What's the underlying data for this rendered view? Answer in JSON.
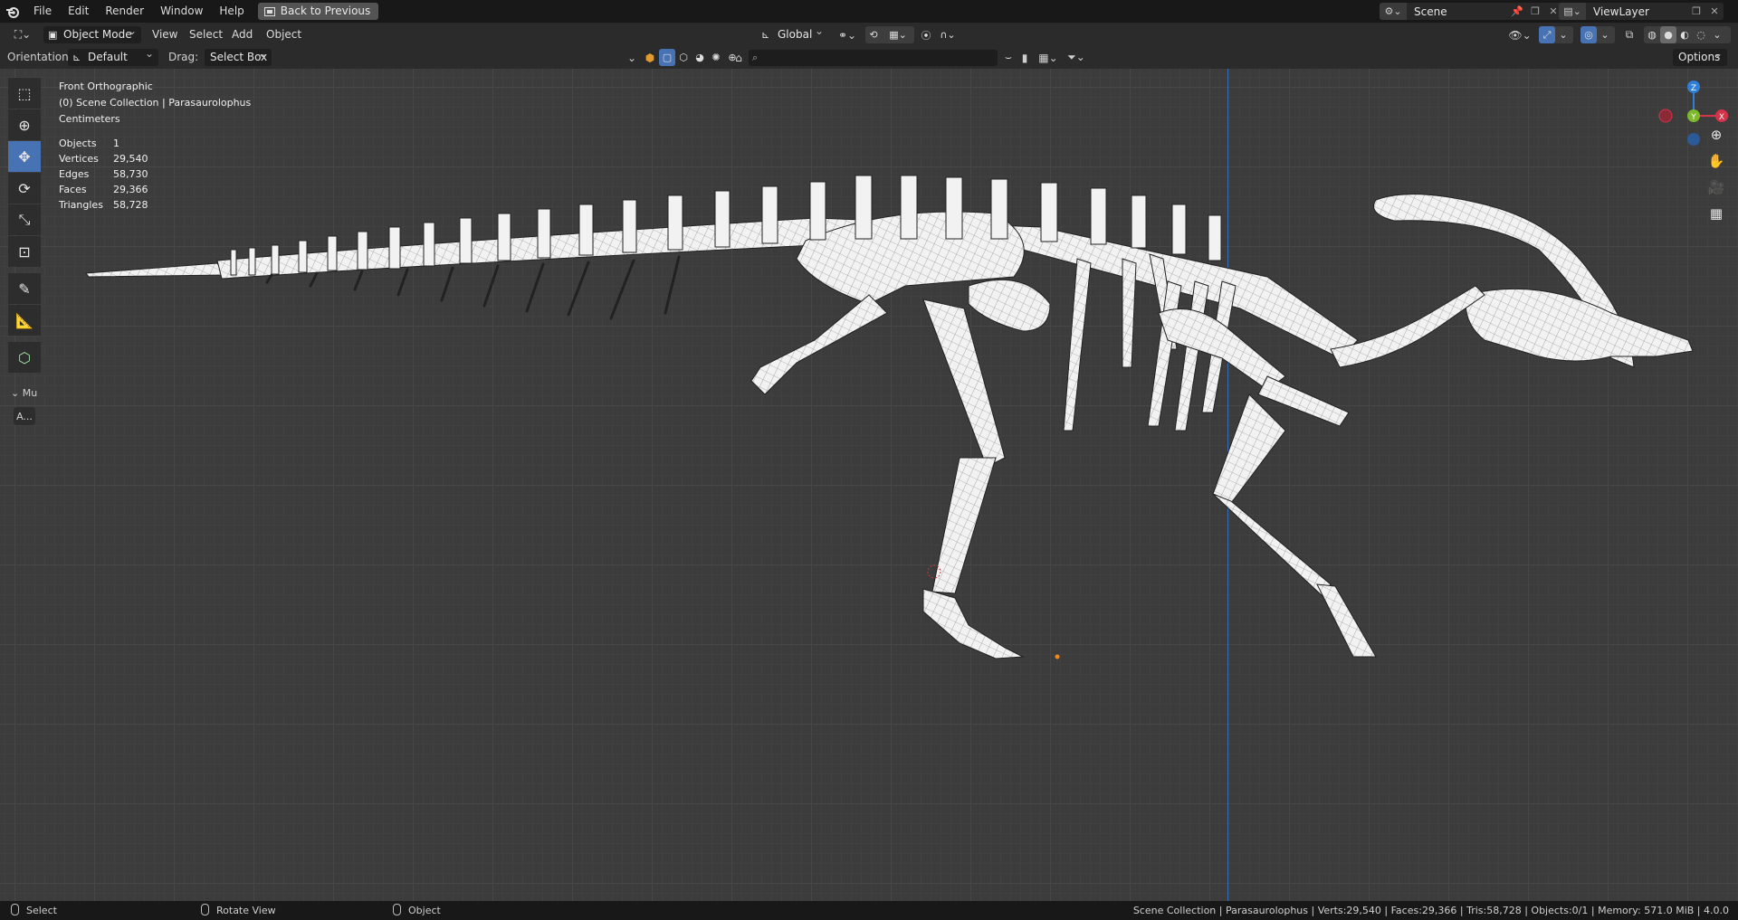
{
  "menubar": {
    "items": [
      "File",
      "Edit",
      "Render",
      "Window",
      "Help"
    ],
    "back_button": "Back to Previous",
    "scene": "Scene",
    "view_layer": "ViewLayer"
  },
  "header": {
    "mode": "Object Mode",
    "menus": [
      "View",
      "Select",
      "Add",
      "Object"
    ],
    "transform_orientation": "Global",
    "orientation_label": "Orientation:",
    "orientation_value": "Default",
    "drag_label": "Drag:",
    "drag_value": "Select Box",
    "options": "Options",
    "search_placeholder": ""
  },
  "viewport": {
    "view_name": "Front Orthographic",
    "collection": "(0) Scene Collection | Parasaurolophus",
    "units": "Centimeters",
    "stats": [
      {
        "label": "Objects",
        "value": "1"
      },
      {
        "label": "Vertices",
        "value": "29,540"
      },
      {
        "label": "Edges",
        "value": "58,730"
      },
      {
        "label": "Faces",
        "value": "29,366"
      },
      {
        "label": "Triangles",
        "value": "58,728"
      }
    ],
    "gizmo": {
      "z": "Z",
      "y": "Y",
      "x": "X"
    },
    "toolbar_collapse": "Mu",
    "toolbar_extra": "A..."
  },
  "statusbar": {
    "left_click": "Select",
    "middle_click": "Rotate View",
    "right_click": "Object",
    "info": "Scene Collection | Parasaurolophus | Verts:29,540 | Faces:29,366 | Tris:58,728 | Objects:0/1 | Memory: 571.0 MiB | 4.0.0"
  },
  "colors": {
    "accent": "#4772b3",
    "axis_x": "#d6324a",
    "axis_y": "#7eb92c",
    "axis_z": "#2f7fd8",
    "mesh": "#f2f2f2"
  }
}
